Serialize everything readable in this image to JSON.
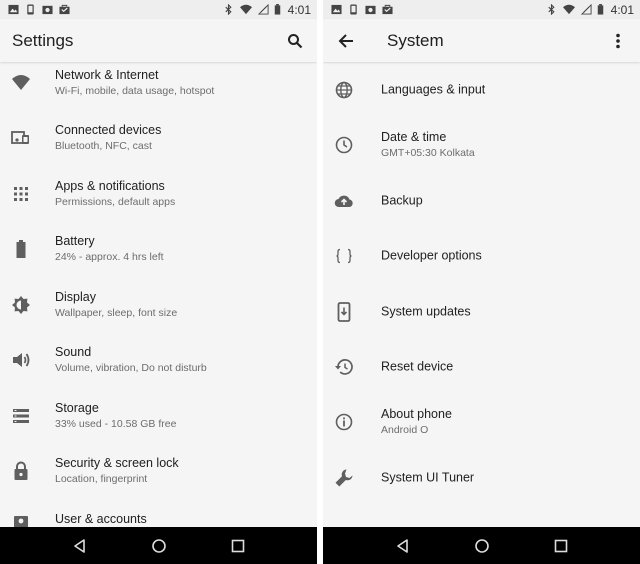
{
  "status_bar": {
    "time": "4:01"
  },
  "left": {
    "title": "Settings",
    "items": [
      {
        "title": "Network & Internet",
        "subtitle": "Wi-Fi, mobile, data usage, hotspot",
        "icon": "wifi-icon"
      },
      {
        "title": "Connected devices",
        "subtitle": "Bluetooth, NFC, cast",
        "icon": "devices-icon"
      },
      {
        "title": "Apps & notifications",
        "subtitle": "Permissions, default apps",
        "icon": "apps-grid-icon"
      },
      {
        "title": "Battery",
        "subtitle": "24% - approx. 4 hrs left",
        "icon": "battery-icon"
      },
      {
        "title": "Display",
        "subtitle": "Wallpaper, sleep, font size",
        "icon": "brightness-icon"
      },
      {
        "title": "Sound",
        "subtitle": "Volume, vibration, Do not disturb",
        "icon": "volume-icon"
      },
      {
        "title": "Storage",
        "subtitle": "33% used - 10.58 GB free",
        "icon": "storage-icon"
      },
      {
        "title": "Security & screen lock",
        "subtitle": "Location, fingerprint",
        "icon": "lock-icon"
      },
      {
        "title": "User & accounts",
        "subtitle": "",
        "icon": "account-icon"
      }
    ]
  },
  "right": {
    "title": "System",
    "items": [
      {
        "title": "Languages & input",
        "subtitle": "",
        "icon": "globe-icon"
      },
      {
        "title": "Date & time",
        "subtitle": "GMT+05:30 Kolkata",
        "icon": "clock-icon"
      },
      {
        "title": "Backup",
        "subtitle": "",
        "icon": "cloud-upload-icon"
      },
      {
        "title": "Developer options",
        "subtitle": "",
        "icon": "braces-icon"
      },
      {
        "title": "System updates",
        "subtitle": "",
        "icon": "system-update-icon"
      },
      {
        "title": "Reset device",
        "subtitle": "",
        "icon": "restore-icon"
      },
      {
        "title": "About phone",
        "subtitle": "Android O",
        "icon": "info-icon"
      },
      {
        "title": "System UI Tuner",
        "subtitle": "",
        "icon": "wrench-icon"
      }
    ]
  },
  "colors": {
    "background": "#f5f5f5",
    "icon": "#5f5f5f",
    "navbar": "#000000"
  }
}
